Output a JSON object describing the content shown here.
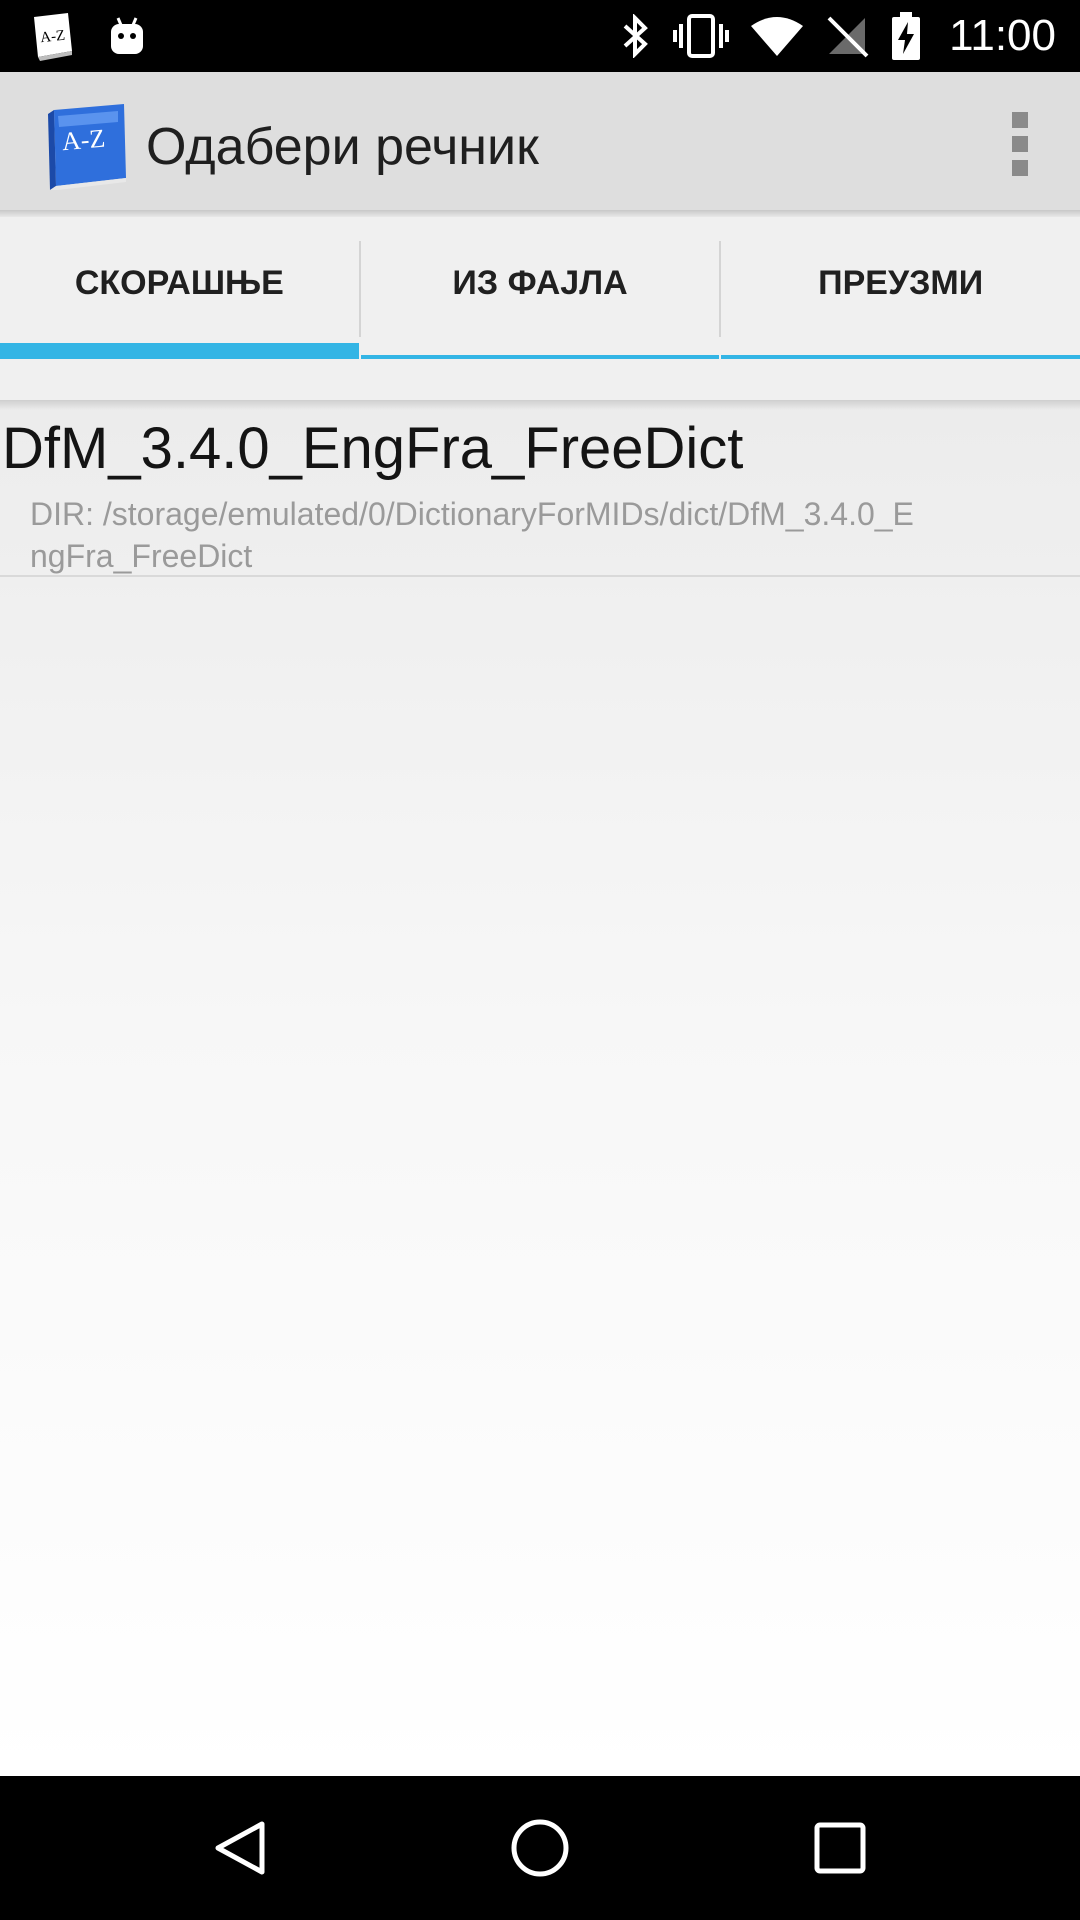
{
  "status_bar": {
    "time": "11:00",
    "left_icons": [
      "az-dictionary-notification-icon",
      "android-debug-icon"
    ],
    "right_icons": [
      "bluetooth-icon",
      "vibrate-icon",
      "wifi-icon",
      "no-sim-icon",
      "battery-charging-icon"
    ]
  },
  "action_bar": {
    "title": "Одабери речник",
    "logo_text": "A-Z",
    "accent_color": "#33b5e5"
  },
  "tabs": [
    {
      "label": "СКОРАШЊЕ",
      "selected": true
    },
    {
      "label": "ИЗ ФАЈЛА",
      "selected": false
    },
    {
      "label": "ПРЕУЗМИ",
      "selected": false
    }
  ],
  "recent_list": [
    {
      "title": "DfM_3.4.0_EngFra_FreeDict",
      "subtitle": "DIR: /storage/emulated/0/DictionaryForMIDs/dict/DfM_3.4.0_EngFra_FreeDict"
    }
  ],
  "nav_bar": {
    "buttons": [
      "back-icon",
      "home-icon",
      "recents-icon"
    ]
  }
}
